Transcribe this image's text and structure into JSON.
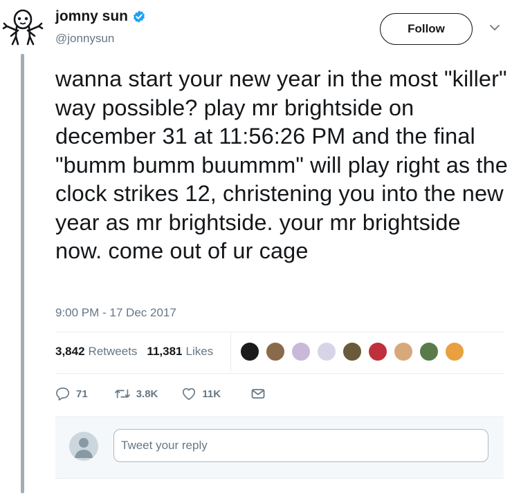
{
  "author": {
    "name": "jomny sun",
    "handle": "@jonnysun",
    "follow_label": "Follow"
  },
  "tweet": {
    "text": "wanna start your new year in the most \"killer\" way possible? play mr brightside on december 31 at 11:56:26 PM and the final \"bumm bumm buummm\" will play right as the clock strikes 12, christening you into the new year as mr brightside. your mr brightside now. come out of ur cage",
    "timestamp": "9:00 PM - 17 Dec 2017"
  },
  "stats": {
    "retweets_count": "3,842",
    "retweets_label": "Retweets",
    "likes_count": "11,381",
    "likes_label": "Likes"
  },
  "actions": {
    "replies": "71",
    "retweets": "3.8K",
    "likes": "11K"
  },
  "reply": {
    "placeholder": "Tweet your reply"
  },
  "colors": {
    "text": "#14171a",
    "muted": "#657786",
    "verified": "#1da1f2",
    "thread_line": "#a3adb5"
  },
  "likers": [
    "#1b1b1b",
    "#8a6a4a",
    "#c9b8d8",
    "#d8d4e8",
    "#6a5a3a",
    "#c0303a",
    "#d9a87a",
    "#5a7a4a",
    "#e8a040"
  ]
}
